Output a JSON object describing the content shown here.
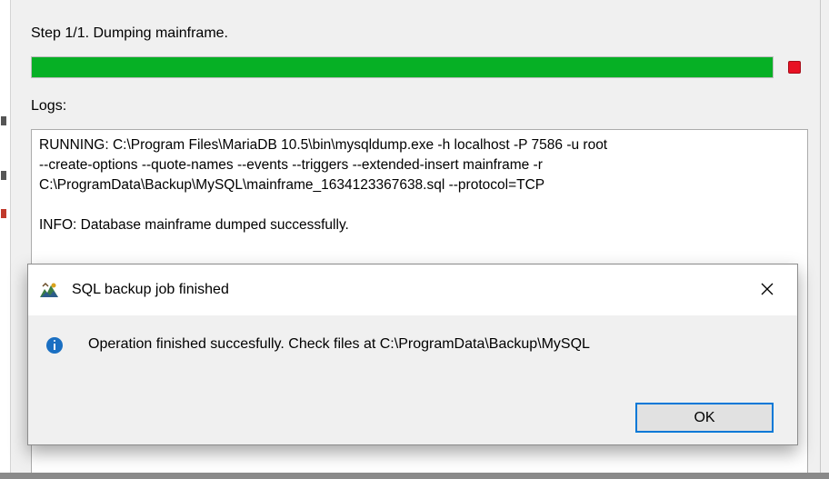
{
  "progress": {
    "step_label": "Step 1/1. Dumping mainframe.",
    "percent": 100,
    "fill_color": "#06b025",
    "stop_color": "#e81123",
    "stop_icon": "stop-square-icon"
  },
  "logs": {
    "label": "Logs:",
    "lines": [
      "RUNNING: C:\\Program Files\\MariaDB 10.5\\bin\\mysqldump.exe -h localhost -P 7586 -u root",
      "--create-options --quote-names --events --triggers --extended-insert mainframe -r",
      "C:\\ProgramData\\Backup\\MySQL\\mainframe_1634123367638.sql --protocol=TCP",
      "",
      "INFO: Database mainframe dumped successfully."
    ]
  },
  "dialog": {
    "title": "SQL backup job finished",
    "app_icon": "backup-app-icon",
    "close_icon": "close-icon",
    "info_icon": "info-icon",
    "message": "Operation finished succesfully. Check files at C:\\ProgramData\\Backup\\MySQL",
    "ok_label": "OK",
    "accent_color": "#0078d7"
  }
}
